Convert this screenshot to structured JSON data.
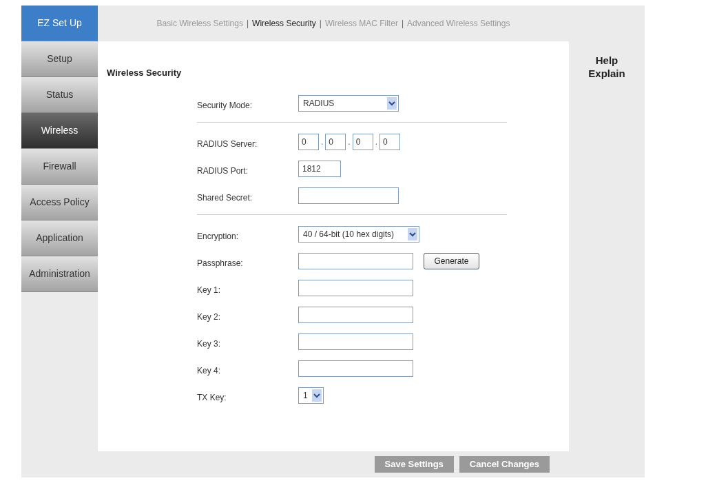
{
  "sidebar": {
    "items": [
      {
        "label": "EZ Set Up",
        "kind": "ez",
        "selected": false
      },
      {
        "label": "Setup",
        "kind": "menu",
        "selected": false
      },
      {
        "label": "Status",
        "kind": "menu",
        "selected": false
      },
      {
        "label": "Wireless",
        "kind": "menu",
        "selected": true
      },
      {
        "label": "Firewall",
        "kind": "menu",
        "selected": false
      },
      {
        "label": "Access Policy",
        "kind": "menu",
        "selected": false
      },
      {
        "label": "Application",
        "kind": "menu",
        "selected": false
      },
      {
        "label": "Administration",
        "kind": "menu",
        "selected": false
      }
    ]
  },
  "tab_separator": "|",
  "tabs": [
    {
      "label": "Basic Wireless Settings",
      "selected": false
    },
    {
      "label": "Wireless Security",
      "selected": true
    },
    {
      "label": "Wireless MAC Filter",
      "selected": false
    },
    {
      "label": "Advanced Wireless Settings",
      "selected": false
    }
  ],
  "section_title": "Wireless Security",
  "form": [
    {
      "kind": "select",
      "label": "Security Mode:",
      "value": "RADIUS"
    },
    {
      "kind": "divider"
    },
    {
      "kind": "ip",
      "label": "RADIUS Server:",
      "separator": ".",
      "octets": [
        "0",
        "0",
        "0",
        "0"
      ]
    },
    {
      "kind": "short_text",
      "label": "RADIUS Port:",
      "value": "1812"
    },
    {
      "kind": "text",
      "label": "Shared Secret:"
    },
    {
      "kind": "divider"
    },
    {
      "kind": "wide_select",
      "label": "Encryption:",
      "value": "40 / 64-bit (10 hex digits)"
    },
    {
      "kind": "text_button",
      "label": "Passphrase:",
      "button": "Generate"
    },
    {
      "kind": "long_text",
      "label": "Key 1:"
    },
    {
      "kind": "long_text",
      "label": "Key 2:"
    },
    {
      "kind": "long_text",
      "label": "Key 3:"
    },
    {
      "kind": "long_text",
      "label": "Key 4:"
    },
    {
      "kind": "small_select",
      "label": "TX Key:",
      "value": "1"
    }
  ],
  "help": {
    "title": "Help",
    "subtitle": "Explain"
  },
  "buttons": [
    {
      "label": "Save Settings",
      "disabled": true
    },
    {
      "label": "Cancel Changes",
      "disabled": true
    }
  ]
}
